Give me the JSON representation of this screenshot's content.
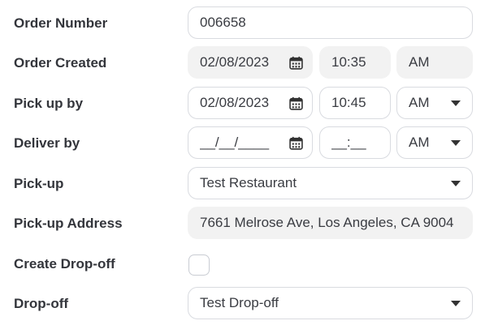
{
  "order_number": {
    "label": "Order Number",
    "value": "006658"
  },
  "order_created": {
    "label": "Order Created",
    "date": "02/08/2023",
    "time": "10:35",
    "ampm": "AM"
  },
  "pick_up_by": {
    "label": "Pick up by",
    "date": "02/08/2023",
    "time": "10:45",
    "ampm": "AM"
  },
  "deliver_by": {
    "label": "Deliver by",
    "date": "__/__/____",
    "time": "__:__",
    "ampm": "AM"
  },
  "pick_up": {
    "label": "Pick-up",
    "value": "Test Restaurant"
  },
  "pick_up_address": {
    "label": "Pick-up Address",
    "value": "7661 Melrose Ave, Los Angeles, CA 9004"
  },
  "create_drop_off": {
    "label": "Create Drop-off",
    "checked": false
  },
  "drop_off": {
    "label": "Drop-off",
    "value": "Test Drop-off"
  }
}
